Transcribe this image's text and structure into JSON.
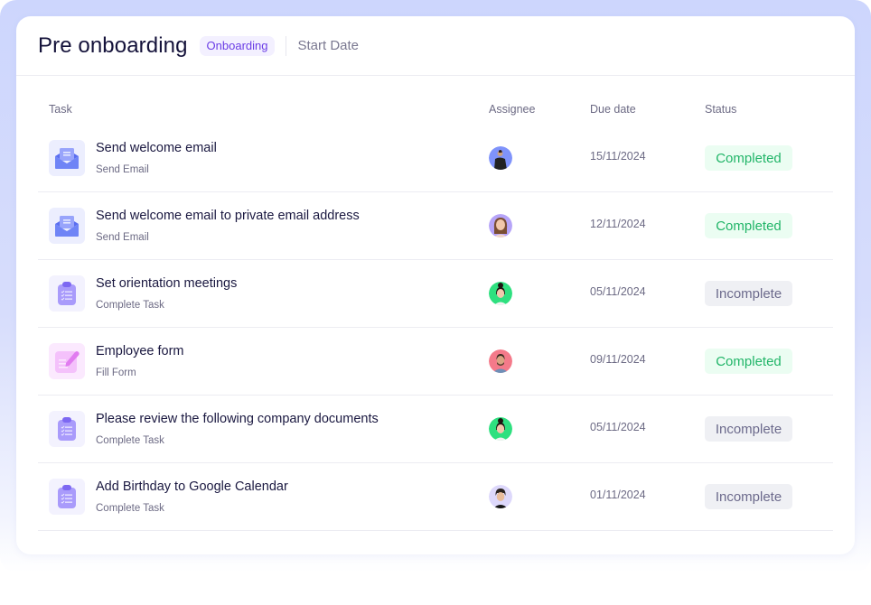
{
  "header": {
    "title": "Pre onboarding",
    "tag": "Onboarding",
    "start_date_label": "Start Date"
  },
  "columns": {
    "task": "Task",
    "assignee": "Assignee",
    "due_date": "Due date",
    "status": "Status"
  },
  "colors": {
    "frame": "#cdd6fd",
    "completed_text": "#21b568",
    "completed_bg": "#ebfdf2",
    "incomplete_text": "#6c6a8c",
    "incomplete_bg": "#eff0f4",
    "tag_text": "#6b3ee6",
    "tag_bg": "#f3f0ff"
  },
  "tasks": [
    {
      "title": "Send welcome email",
      "type": "Send Email",
      "icon": "envelope-icon",
      "assignee_avatar": "avatar-man-blue",
      "due": "15/11/2024",
      "status": "Completed"
    },
    {
      "title": "Send welcome email to private email address",
      "type": "Send Email",
      "icon": "envelope-icon",
      "assignee_avatar": "avatar-woman-purple",
      "due": "12/11/2024",
      "status": "Completed"
    },
    {
      "title": "Set orientation meetings",
      "type": "Complete Task",
      "icon": "clipboard-checklist-icon",
      "assignee_avatar": "avatar-woman-green",
      "due": "05/11/2024",
      "status": "Incomplete"
    },
    {
      "title": "Employee form",
      "type": "Fill Form",
      "icon": "form-pencil-icon",
      "assignee_avatar": "avatar-man-pink",
      "due": "09/11/2024",
      "status": "Completed"
    },
    {
      "title": "Please review the following company documents",
      "type": "Complete Task",
      "icon": "clipboard-checklist-icon",
      "assignee_avatar": "avatar-woman-green",
      "due": "05/11/2024",
      "status": "Incomplete"
    },
    {
      "title": "Add Birthday to Google Calendar",
      "type": "Complete Task",
      "icon": "clipboard-checklist-icon",
      "assignee_avatar": "avatar-man-lavender",
      "due": "01/11/2024",
      "status": "Incomplete"
    }
  ]
}
